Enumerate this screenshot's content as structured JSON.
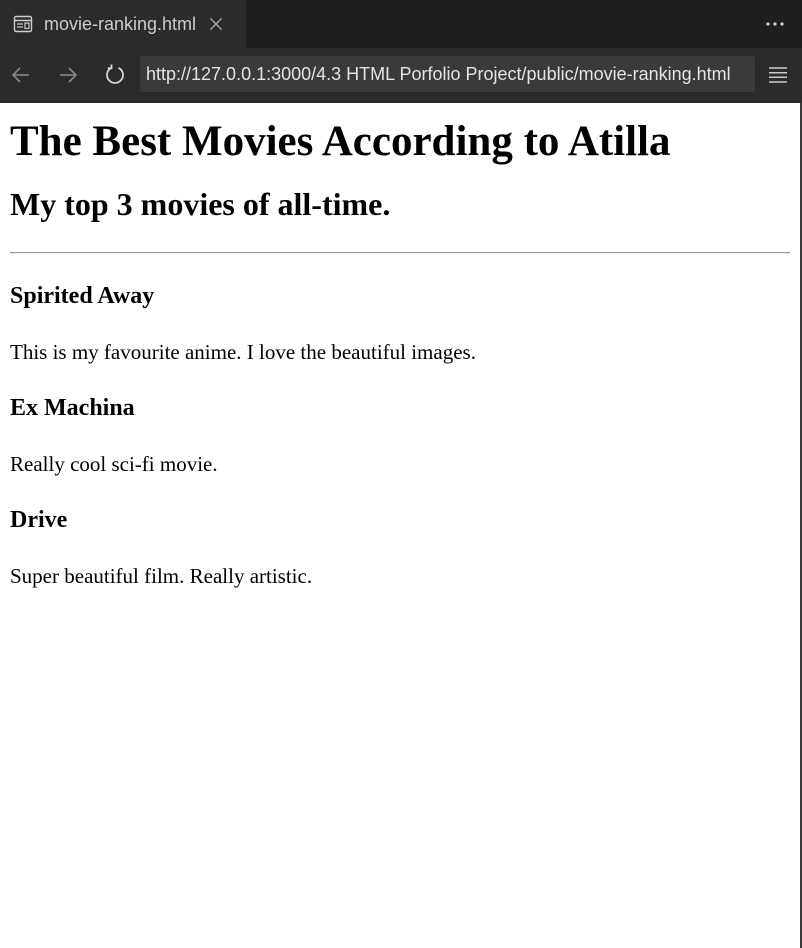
{
  "browser": {
    "tab": {
      "label": "movie-ranking.html",
      "icon": "preview-page-icon",
      "close_icon": "close-icon"
    },
    "more_actions_icon": "ellipsis-icon",
    "nav": {
      "back_icon": "arrow-left-icon",
      "forward_icon": "arrow-right-icon",
      "reload_icon": "reload-icon",
      "url": "http://127.0.0.1:3000/4.3 HTML Porfolio Project/public/movie-ranking.html",
      "menu_icon": "hamburger-menu-icon"
    },
    "colors": {
      "chrome_dark": "#1f1f1f",
      "chrome_mid": "#2b2b2b",
      "url_bg": "#3a3a3a",
      "chrome_text": "#cccccc",
      "page_bg": "#ffffff",
      "page_text": "#000000"
    }
  },
  "page": {
    "title": "The Best Movies According to Atilla",
    "subtitle": "My top 3 movies of all-time.",
    "movies": [
      {
        "title": "Spirited Away",
        "description": "This is my favourite anime. I love the beautiful images."
      },
      {
        "title": "Ex Machina",
        "description": "Really cool sci-fi movie."
      },
      {
        "title": "Drive",
        "description": "Super beautiful film. Really artistic."
      }
    ]
  }
}
